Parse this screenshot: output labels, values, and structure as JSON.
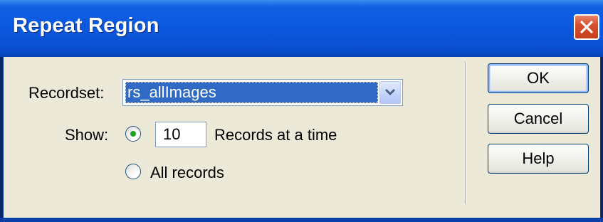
{
  "window": {
    "title": "Repeat Region"
  },
  "form": {
    "recordset_label": "Recordset:",
    "recordset_value": "rs_allImages",
    "show_label": "Show:",
    "records_count": "10",
    "records_at_a_time_label": "Records at a time",
    "all_records_label": "All records",
    "selected_option": "records-at-a-time"
  },
  "buttons": {
    "ok": "OK",
    "cancel": "Cancel",
    "help": "Help"
  },
  "colors": {
    "titlebar": "#0b58de",
    "dialog_bg": "#ece9d8",
    "selection": "#316ac5",
    "close_button": "#d8502c",
    "radio_dot": "#21a121"
  },
  "icons": {
    "close": "close-icon",
    "dropdown": "chevron-down-icon"
  }
}
